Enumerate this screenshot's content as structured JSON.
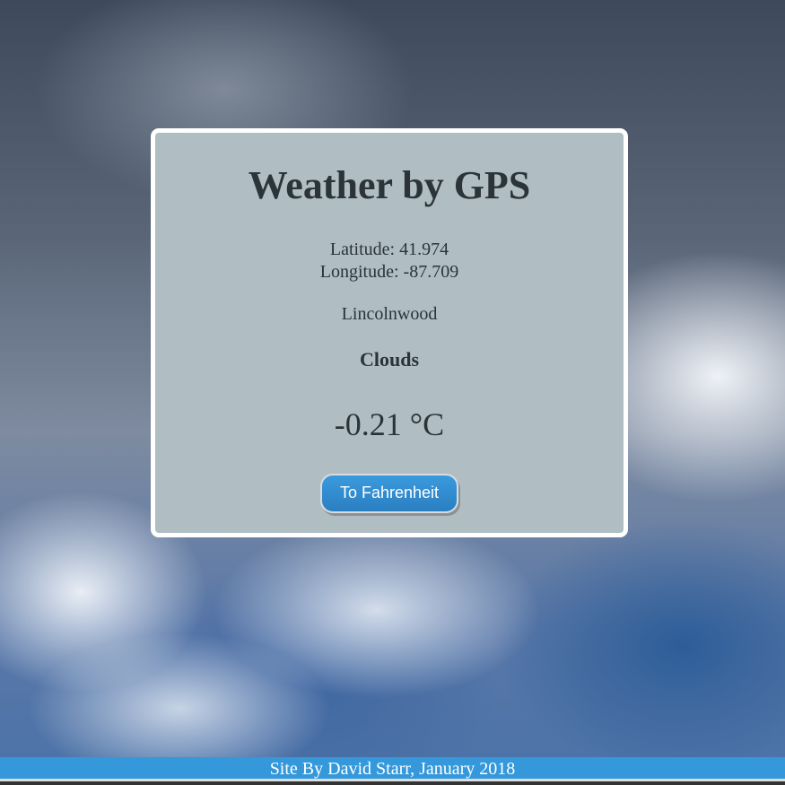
{
  "title": "Weather by GPS",
  "latitude": "Latitude: 41.974",
  "longitude": "Longitude: -87.709",
  "city": "Lincolnwood",
  "condition": "Clouds",
  "temperature": "-0.21 °C",
  "toggle_button": "To Fahrenheit",
  "footer": "Site By David Starr, January 2018",
  "colors": {
    "accent": "#3498db",
    "card": "#b0bec4"
  }
}
